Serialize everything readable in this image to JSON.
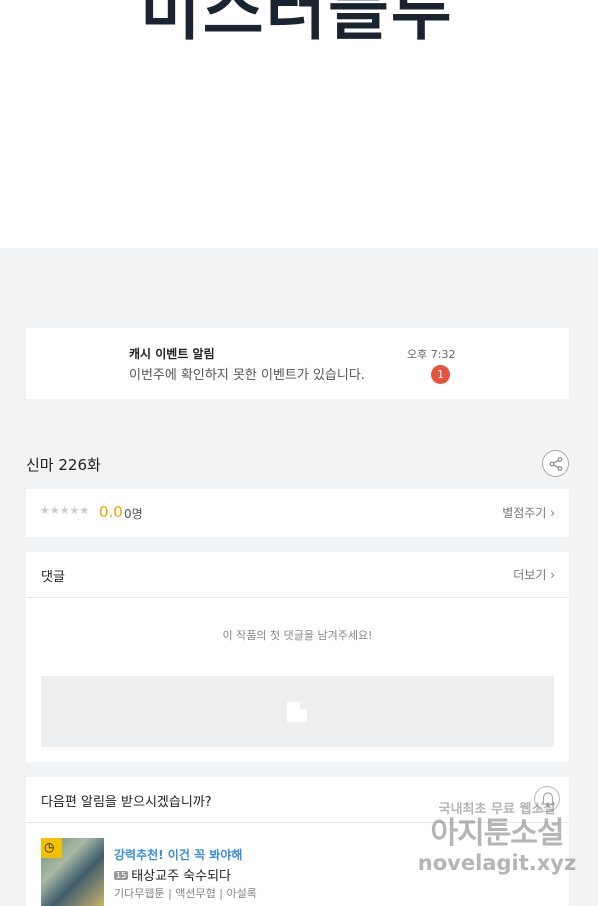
{
  "header": {
    "title_art": "미스터블루"
  },
  "notice": {
    "title": "캐시 이벤트 알림",
    "text": "이번주에 확인하지 못한 이벤트가 있습니다.",
    "time": "오후 7:32",
    "badge": "1"
  },
  "episode": {
    "title": "신마 226화",
    "share_icon": "share-icon"
  },
  "rating": {
    "stars": "★★★★★",
    "score": "0.0",
    "count": "0명",
    "rate_label": "별점주기 ›",
    "star_color": "#cccccc",
    "score_color": "#f5a400"
  },
  "comments": {
    "title": "댓글",
    "more_label": "더보기 ›",
    "empty_text": "이 작품의 첫 댓글을 남겨주세요!"
  },
  "next_alert": {
    "title": "다음편 알림을 받으시겠습니까?",
    "bell_icon": "bell-icon",
    "recommend_label": "강력추천! 이건 꼭 봐야해",
    "age_badge": "15",
    "work_title": "태상교주 숙수되다",
    "tags": "기다무웹툰 | 액션무협 | 아설록",
    "recommend_color": "#3b8de0"
  },
  "watermark": {
    "line1": "국내최초 무료 웹소설",
    "line2": "아지툰소설",
    "line3": "novelagit.xyz"
  }
}
